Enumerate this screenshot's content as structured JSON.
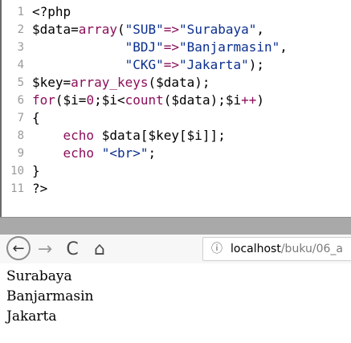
{
  "editor": {
    "lines": [
      {
        "number": "1",
        "parts": [
          {
            "t": "<?php",
            "c": "plain"
          }
        ]
      },
      {
        "number": "2",
        "parts": [
          {
            "t": "$data=",
            "c": "plain"
          },
          {
            "t": "array",
            "c": "kw"
          },
          {
            "t": "(",
            "c": "plain"
          },
          {
            "t": "\"SUB\"",
            "c": "str"
          },
          {
            "t": "=>",
            "c": "kw"
          },
          {
            "t": "\"Surabaya\"",
            "c": "str"
          },
          {
            "t": ",",
            "c": "plain"
          }
        ]
      },
      {
        "number": "3",
        "parts": [
          {
            "t": "            ",
            "c": "plain"
          },
          {
            "t": "\"BDJ\"",
            "c": "str"
          },
          {
            "t": "=>",
            "c": "kw"
          },
          {
            "t": "\"Banjarmasin\"",
            "c": "str"
          },
          {
            "t": ",",
            "c": "plain"
          }
        ]
      },
      {
        "number": "4",
        "parts": [
          {
            "t": "            ",
            "c": "plain"
          },
          {
            "t": "\"CKG\"",
            "c": "str"
          },
          {
            "t": "=>",
            "c": "kw"
          },
          {
            "t": "\"Jakarta\"",
            "c": "str"
          },
          {
            "t": ");",
            "c": "plain"
          }
        ]
      },
      {
        "number": "5",
        "parts": [
          {
            "t": "$key=",
            "c": "plain"
          },
          {
            "t": "array_keys",
            "c": "kw"
          },
          {
            "t": "($data);",
            "c": "plain"
          }
        ]
      },
      {
        "number": "6",
        "parts": [
          {
            "t": "for",
            "c": "kw"
          },
          {
            "t": "($i=",
            "c": "plain"
          },
          {
            "t": "0",
            "c": "num"
          },
          {
            "t": ";$i<",
            "c": "plain"
          },
          {
            "t": "count",
            "c": "kw"
          },
          {
            "t": "($data);$i",
            "c": "plain"
          },
          {
            "t": "++",
            "c": "kw"
          },
          {
            "t": ")",
            "c": "plain"
          }
        ]
      },
      {
        "number": "7",
        "parts": [
          {
            "t": "{",
            "c": "plain"
          }
        ]
      },
      {
        "number": "8",
        "parts": [
          {
            "t": "    ",
            "c": "plain"
          },
          {
            "t": "echo",
            "c": "kw"
          },
          {
            "t": " $data[$key[$i]];",
            "c": "plain"
          }
        ]
      },
      {
        "number": "9",
        "parts": [
          {
            "t": "    ",
            "c": "plain"
          },
          {
            "t": "echo",
            "c": "kw"
          },
          {
            "t": " ",
            "c": "plain"
          },
          {
            "t": "\"<br>\"",
            "c": "str"
          },
          {
            "t": ";",
            "c": "plain"
          }
        ]
      },
      {
        "number": "10",
        "parts": [
          {
            "t": "}",
            "c": "plain"
          }
        ]
      },
      {
        "number": "11",
        "parts": [
          {
            "t": "?>",
            "c": "plain"
          }
        ]
      }
    ]
  },
  "browser": {
    "back_icon": "←",
    "forward_icon": "→",
    "reload_icon": "C",
    "home_icon": "⌂",
    "info_icon": "ⓘ",
    "url_host": "localhost",
    "url_path": "/buku/06_a"
  },
  "output": {
    "lines": [
      "Surabaya",
      "Banjarmasin",
      "Jakarta"
    ]
  }
}
